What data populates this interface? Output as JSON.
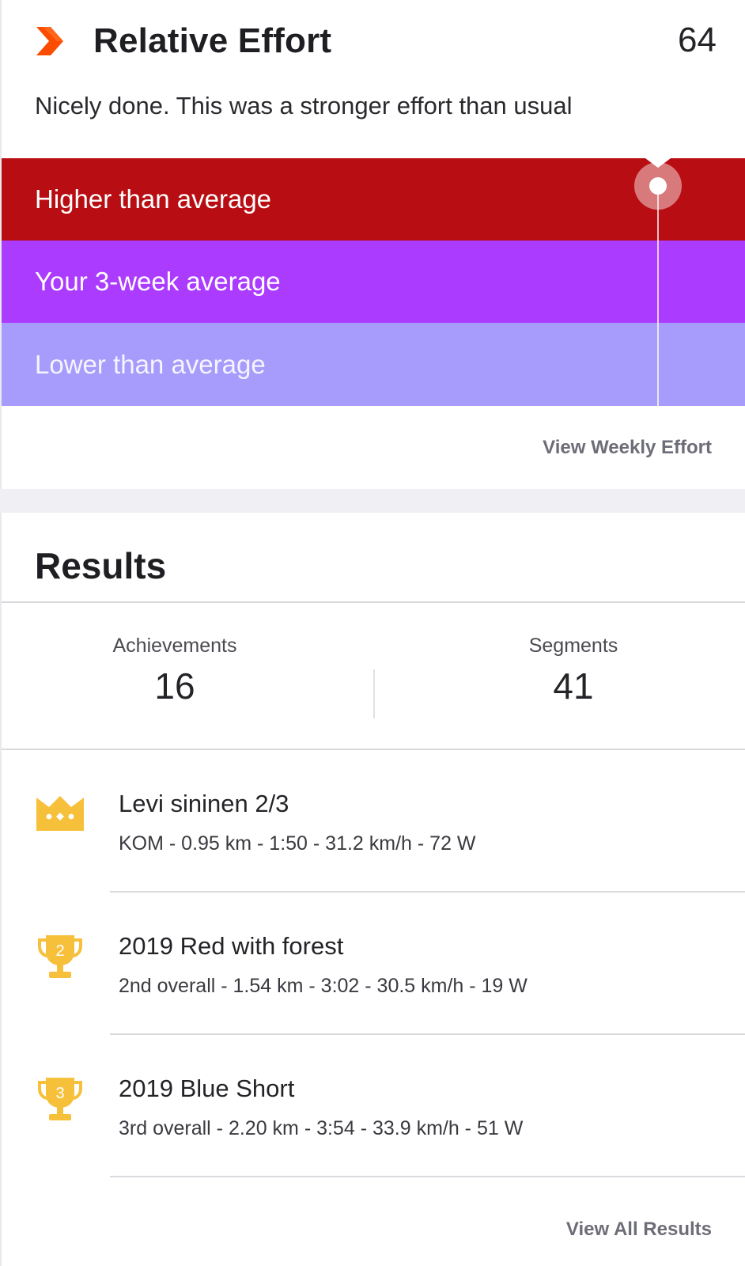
{
  "relative_effort": {
    "title": "Relative Effort",
    "score": "64",
    "message": "Nicely done. This was a stronger effort than usual",
    "bands": {
      "higher": "Higher than average",
      "average": "Your 3-week average",
      "lower": "Lower than average"
    },
    "colors": {
      "higher": "#b80d12",
      "average": "#ab3bff",
      "lower": "#a79cfc",
      "logo": "#fc4c02"
    },
    "view_weekly_label": "View Weekly Effort"
  },
  "results": {
    "title": "Results",
    "achievements_label": "Achievements",
    "achievements_value": "16",
    "segments_label": "Segments",
    "segments_value": "41",
    "items": [
      {
        "icon": "crown-icon",
        "name": "Levi sininen 2/3",
        "detail": "KOM - 0.95 km - 1:50 - 31.2 km/h - 72 W"
      },
      {
        "icon": "trophy-2-icon",
        "rank": "2",
        "name": "2019 Red with forest",
        "detail": "2nd overall - 1.54 km - 3:02 - 30.5 km/h - 19 W"
      },
      {
        "icon": "trophy-3-icon",
        "rank": "3",
        "name": "2019 Blue Short",
        "detail": "3rd overall - 2.20 km - 3:54 - 33.9 km/h - 51 W"
      }
    ],
    "view_all_label": "View All Results",
    "icon_color": "#f7c03a"
  }
}
